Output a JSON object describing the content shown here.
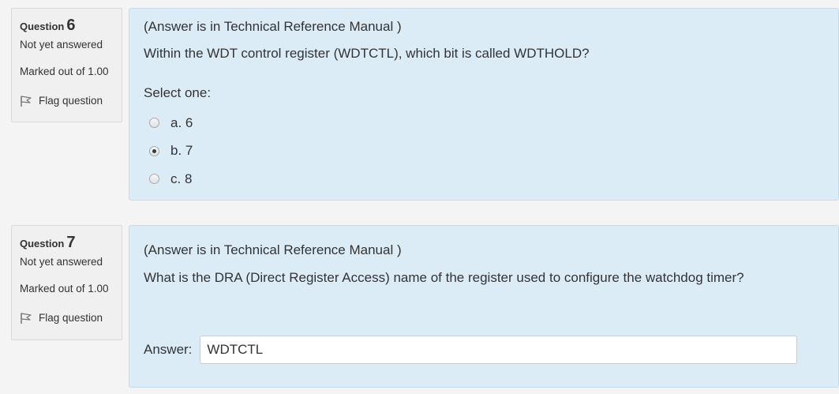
{
  "questions": [
    {
      "label": "Question",
      "number": "6",
      "state": "Not yet answered",
      "grade": "Marked out of 1.00",
      "flag_label": "Flag question",
      "note": "(Answer is in  Technical Reference Manual )",
      "text": "Within the WDT control register (WDTCTL), which bit is called WDTHOLD?",
      "prompt": "Select one:",
      "options": [
        {
          "label": "a. 6",
          "selected": false
        },
        {
          "label": "b. 7",
          "selected": true
        },
        {
          "label": "c. 8",
          "selected": false
        }
      ]
    },
    {
      "label": "Question",
      "number": "7",
      "state": "Not yet answered",
      "grade": "Marked out of 1.00",
      "flag_label": "Flag question",
      "note": "(Answer is in  Technical Reference Manual )",
      "text": "What is the DRA (Direct Register Access) name of the register used to configure the watchdog timer?",
      "answer_label": "Answer:",
      "answer_value": "WDTCTL"
    }
  ],
  "icons": {
    "flag": "flag-icon",
    "radio": "radio-icon"
  },
  "colors": {
    "content_bg": "#dcecf6",
    "info_bg": "#f0f0f0",
    "page_bg": "#f4f4f4"
  }
}
